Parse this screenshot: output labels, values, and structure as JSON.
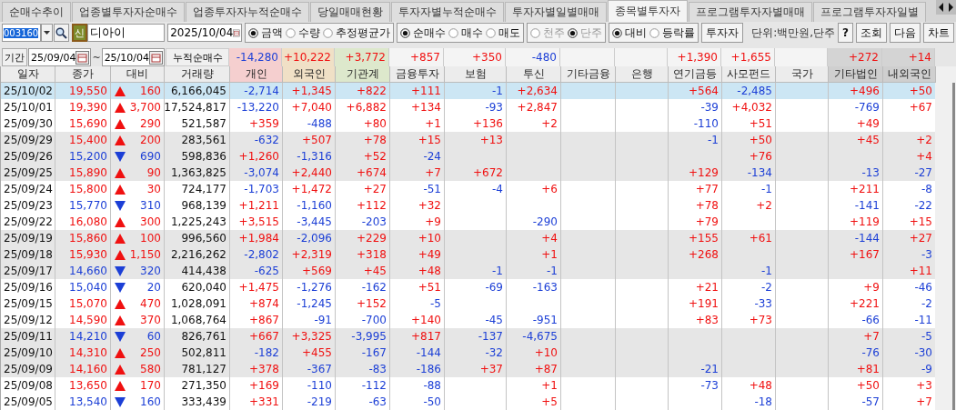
{
  "tabs": [
    {
      "label": "순매수추이",
      "selected": false
    },
    {
      "label": "업종별투자자순매수",
      "selected": false
    },
    {
      "label": "업종투자자누적순매수",
      "selected": false
    },
    {
      "label": "당일매매현황",
      "selected": false
    },
    {
      "label": "투자자별누적순매수",
      "selected": false
    },
    {
      "label": "투자자별일별매매",
      "selected": false
    },
    {
      "label": "종목별투자자",
      "selected": true
    },
    {
      "label": "프로그램투자자별매매",
      "selected": false
    },
    {
      "label": "프로그램투자자일별",
      "selected": false
    }
  ],
  "toolbar": {
    "code": "003160",
    "badge": "신",
    "name": "디아이",
    "date": "2025/10/04",
    "radio_groups": [
      {
        "disabled": false,
        "options": [
          {
            "label": "금액",
            "selected": true
          },
          {
            "label": "수량",
            "selected": false
          },
          {
            "label": "추정평균가",
            "selected": false
          }
        ]
      },
      {
        "disabled": false,
        "options": [
          {
            "label": "순매수",
            "selected": true
          },
          {
            "label": "매수",
            "selected": false
          },
          {
            "label": "매도",
            "selected": false
          }
        ]
      },
      {
        "disabled": true,
        "options": [
          {
            "label": "천주",
            "selected": false
          },
          {
            "label": "단주",
            "selected": true
          }
        ]
      },
      {
        "disabled": false,
        "options": [
          {
            "label": "대비",
            "selected": true
          },
          {
            "label": "등락률",
            "selected": false
          }
        ]
      }
    ],
    "investor_button": "투자자",
    "unit": "단위:백만원,단주",
    "buttons": [
      "?",
      "조회",
      "다음",
      "차트"
    ]
  },
  "period": {
    "label": "기간",
    "from": "25/09/04",
    "separator": "~",
    "to": "25/10/04",
    "total_label": "누적순매수",
    "totals": {
      "individual": "-14,280",
      "foreign": "+10,222",
      "institution": "+3,772",
      "financial_investment": "+857",
      "insurance": "+350",
      "trust": "-480",
      "pension": "+1,390",
      "private_fund": "+1,655",
      "other_corp": "+272",
      "domestic_foreign": "+14"
    }
  },
  "table": {
    "columns": [
      "일자",
      "종가",
      "대비",
      "거래량",
      "개인",
      "외국인",
      "기관계",
      "금융투자",
      "보험",
      "투신",
      "기타금융",
      "은행",
      "연기금등",
      "사모펀드",
      "국가",
      "기타법인",
      "내외국인"
    ],
    "rows": [
      {
        "date": "25/10/02",
        "close": "19,550",
        "rising": true,
        "change": "160",
        "volume": "6,166,045",
        "selected": true,
        "values": {
          "individual": "-2,714",
          "foreign": "+1,345",
          "institution": "+822",
          "financial_investment": "+111",
          "insurance": "-1",
          "trust": "+2,634",
          "pension": "+564",
          "private_fund": "-2,485",
          "other_corp": "+496",
          "domestic_foreign": "+50"
        }
      },
      {
        "date": "25/10/01",
        "close": "19,390",
        "rising": true,
        "change": "3,700",
        "volume": "17,524,817",
        "selected": false,
        "values": {
          "individual": "-13,220",
          "foreign": "+7,040",
          "institution": "+6,882",
          "financial_investment": "+134",
          "insurance": "-93",
          "trust": "+2,847",
          "pension": "-39",
          "private_fund": "+4,032",
          "other_corp": "-769",
          "domestic_foreign": "+67"
        }
      },
      {
        "date": "25/09/30",
        "close": "15,690",
        "rising": true,
        "change": "290",
        "volume": "521,587",
        "selected": false,
        "values": {
          "individual": "+359",
          "foreign": "-488",
          "institution": "+80",
          "financial_investment": "+1",
          "insurance": "+136",
          "trust": "+2",
          "pension": "-110",
          "private_fund": "+51",
          "other_corp": "+49"
        }
      },
      {
        "date": "25/09/29",
        "close": "15,400",
        "rising": true,
        "change": "200",
        "volume": "283,561",
        "selected": false,
        "values": {
          "individual": "-632",
          "foreign": "+507",
          "institution": "+78",
          "financial_investment": "+15",
          "insurance": "+13",
          "pension": "-1",
          "private_fund": "+50",
          "other_corp": "+45",
          "domestic_foreign": "+2"
        }
      },
      {
        "date": "25/09/26",
        "close": "15,200",
        "rising": false,
        "change": "690",
        "volume": "598,836",
        "selected": false,
        "values": {
          "individual": "+1,260",
          "foreign": "-1,316",
          "institution": "+52",
          "financial_investment": "-24",
          "private_fund": "+76",
          "domestic_foreign": "+4"
        }
      },
      {
        "date": "25/09/25",
        "close": "15,890",
        "rising": true,
        "change": "90",
        "volume": "1,363,825",
        "selected": false,
        "values": {
          "individual": "-3,074",
          "foreign": "+2,440",
          "institution": "+674",
          "financial_investment": "+7",
          "insurance": "+672",
          "pension": "+129",
          "private_fund": "-134",
          "other_corp": "-13",
          "domestic_foreign": "-27"
        }
      },
      {
        "date": "25/09/24",
        "close": "15,800",
        "rising": true,
        "change": "30",
        "volume": "724,177",
        "selected": false,
        "values": {
          "individual": "-1,703",
          "foreign": "+1,472",
          "institution": "+27",
          "financial_investment": "-51",
          "insurance": "-4",
          "trust": "+6",
          "pension": "+77",
          "private_fund": "-1",
          "other_corp": "+211",
          "domestic_foreign": "-8"
        }
      },
      {
        "date": "25/09/23",
        "close": "15,770",
        "rising": false,
        "change": "310",
        "volume": "968,139",
        "selected": false,
        "values": {
          "individual": "+1,211",
          "foreign": "-1,160",
          "institution": "+112",
          "financial_investment": "+32",
          "pension": "+78",
          "private_fund": "+2",
          "other_corp": "-141",
          "domestic_foreign": "-22"
        }
      },
      {
        "date": "25/09/22",
        "close": "16,080",
        "rising": true,
        "change": "300",
        "volume": "1,225,243",
        "selected": false,
        "values": {
          "individual": "+3,515",
          "foreign": "-3,445",
          "institution": "-203",
          "financial_investment": "+9",
          "trust": "-290",
          "pension": "+79",
          "other_corp": "+119",
          "domestic_foreign": "+15"
        }
      },
      {
        "date": "25/09/19",
        "close": "15,860",
        "rising": true,
        "change": "100",
        "volume": "996,560",
        "selected": false,
        "values": {
          "individual": "+1,984",
          "foreign": "-2,096",
          "institution": "+229",
          "financial_investment": "+10",
          "trust": "+4",
          "pension": "+155",
          "private_fund": "+61",
          "other_corp": "-144",
          "domestic_foreign": "+27"
        }
      },
      {
        "date": "25/09/18",
        "close": "15,930",
        "rising": true,
        "change": "1,150",
        "volume": "2,216,262",
        "selected": false,
        "values": {
          "individual": "-2,802",
          "foreign": "+2,319",
          "institution": "+318",
          "financial_investment": "+49",
          "trust": "+1",
          "pension": "+268",
          "other_corp": "+167",
          "domestic_foreign": "-3"
        }
      },
      {
        "date": "25/09/17",
        "close": "14,660",
        "rising": false,
        "change": "320",
        "volume": "414,438",
        "selected": false,
        "values": {
          "individual": "-625",
          "foreign": "+569",
          "institution": "+45",
          "financial_investment": "+48",
          "insurance": "-1",
          "trust": "-1",
          "private_fund": "-1",
          "domestic_foreign": "+11"
        }
      },
      {
        "date": "25/09/16",
        "close": "15,040",
        "rising": false,
        "change": "20",
        "volume": "620,040",
        "selected": false,
        "values": {
          "individual": "+1,475",
          "foreign": "-1,276",
          "institution": "-162",
          "financial_investment": "+51",
          "insurance": "-69",
          "trust": "-163",
          "pension": "+21",
          "private_fund": "-2",
          "other_corp": "+9",
          "domestic_foreign": "-46"
        }
      },
      {
        "date": "25/09/15",
        "close": "15,070",
        "rising": true,
        "change": "470",
        "volume": "1,028,091",
        "selected": false,
        "values": {
          "individual": "+874",
          "foreign": "-1,245",
          "institution": "+152",
          "financial_investment": "-5",
          "pension": "+191",
          "private_fund": "-33",
          "other_corp": "+221",
          "domestic_foreign": "-2"
        }
      },
      {
        "date": "25/09/12",
        "close": "14,590",
        "rising": true,
        "change": "370",
        "volume": "1,068,764",
        "selected": false,
        "values": {
          "individual": "+867",
          "foreign": "-91",
          "institution": "-700",
          "financial_investment": "+140",
          "insurance": "-45",
          "trust": "-951",
          "pension": "+83",
          "private_fund": "+73",
          "other_corp": "-66",
          "domestic_foreign": "-11"
        }
      },
      {
        "date": "25/09/11",
        "close": "14,210",
        "rising": false,
        "change": "60",
        "volume": "826,761",
        "selected": false,
        "values": {
          "individual": "+667",
          "foreign": "+3,325",
          "institution": "-3,995",
          "financial_investment": "+817",
          "insurance": "-137",
          "trust": "-4,675",
          "other_corp": "+7",
          "domestic_foreign": "-5"
        }
      },
      {
        "date": "25/09/10",
        "close": "14,310",
        "rising": true,
        "change": "250",
        "volume": "502,811",
        "selected": false,
        "values": {
          "individual": "-182",
          "foreign": "+455",
          "institution": "-167",
          "financial_investment": "-144",
          "insurance": "-32",
          "trust": "+10",
          "other_corp": "-76",
          "domestic_foreign": "-30"
        }
      },
      {
        "date": "25/09/09",
        "close": "14,160",
        "rising": true,
        "change": "580",
        "volume": "781,127",
        "selected": false,
        "values": {
          "individual": "+378",
          "foreign": "-367",
          "institution": "-83",
          "financial_investment": "-186",
          "insurance": "+37",
          "trust": "+87",
          "pension": "-21",
          "other_corp": "+81",
          "domestic_foreign": "-9"
        }
      },
      {
        "date": "25/09/08",
        "close": "13,650",
        "rising": true,
        "change": "170",
        "volume": "271,350",
        "selected": false,
        "values": {
          "individual": "+169",
          "foreign": "-110",
          "institution": "-112",
          "financial_investment": "-88",
          "trust": "+1",
          "pension": "-73",
          "private_fund": "+48",
          "other_corp": "+50",
          "domestic_foreign": "+3"
        }
      },
      {
        "date": "25/09/05",
        "close": "13,540",
        "rising": false,
        "change": "160",
        "volume": "333,439",
        "selected": false,
        "values": {
          "individual": "+331",
          "foreign": "-219",
          "institution": "-63",
          "financial_investment": "-50",
          "trust": "+5",
          "private_fund": "-18",
          "other_corp": "-57",
          "domestic_foreign": "+7"
        }
      }
    ]
  }
}
